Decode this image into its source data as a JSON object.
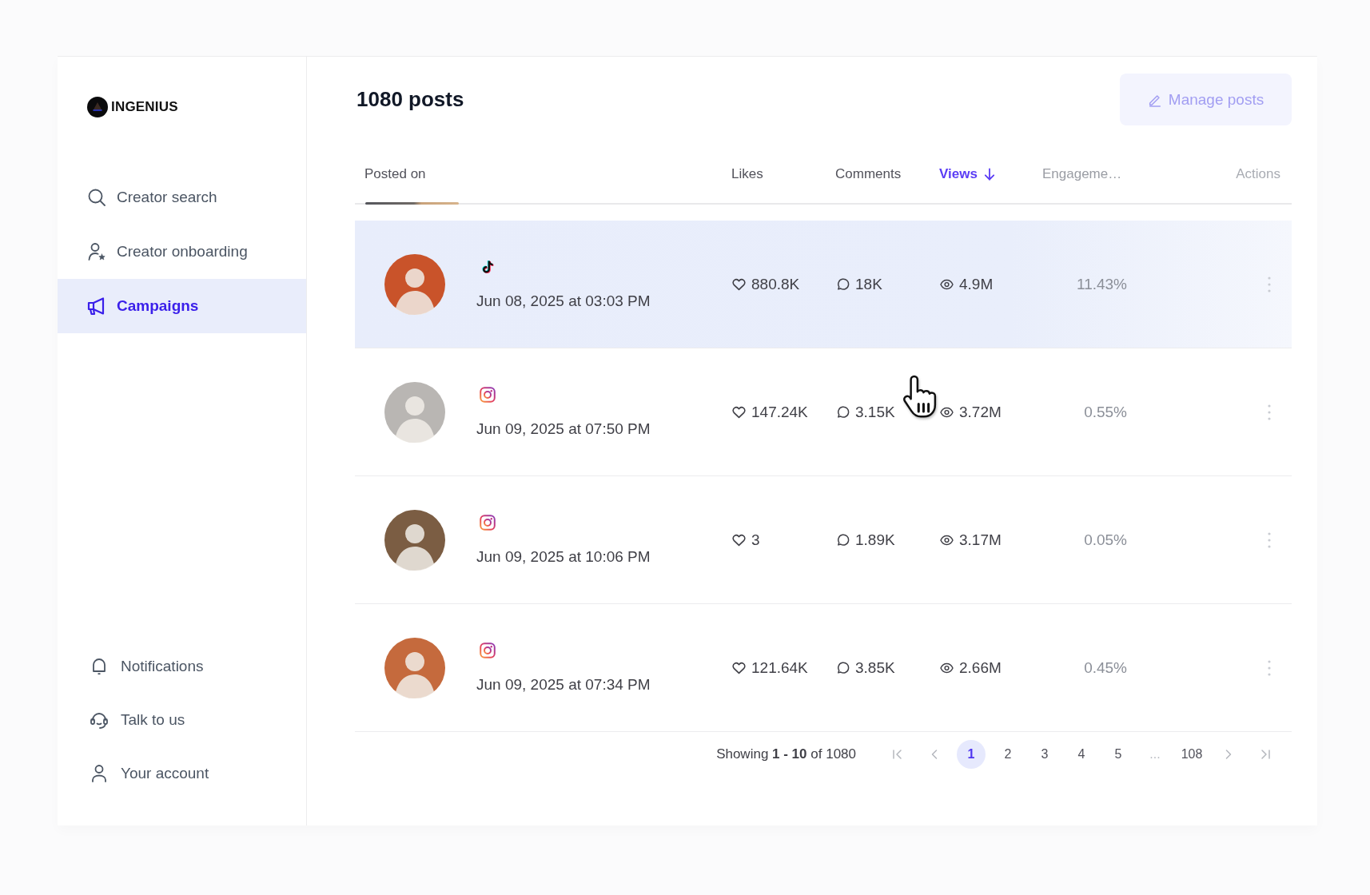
{
  "sidebar": {
    "logo": {
      "text": "INGENIUS"
    },
    "nav_items": [
      {
        "label": "Creator search",
        "selected": false
      },
      {
        "label": "Creator onboarding",
        "selected": false
      },
      {
        "label": "Campaigns",
        "selected": true
      }
    ],
    "bottom_items": [
      {
        "label": "Notifications"
      },
      {
        "label": "Talk to us"
      },
      {
        "label": "Your account"
      }
    ]
  },
  "header": {
    "title": "1080 posts",
    "manage_button": {
      "label": "Manage posts"
    }
  },
  "table": {
    "columns": [
      {
        "label": "Posted on",
        "sorted": false
      },
      {
        "label": "Likes",
        "sorted": false
      },
      {
        "label": "Comments",
        "sorted": false
      },
      {
        "label": "Views",
        "sorted": true
      },
      {
        "label": "Engageme…",
        "sorted": false
      },
      {
        "label": "Actions",
        "sorted": false
      }
    ],
    "rows": [
      {
        "selected": true,
        "kind": "tiktok",
        "posted_on": "Jun 08, 2025 at 03:03 PM",
        "likes": "880.8K",
        "comments": "18K",
        "views": "4.9M",
        "engagement": "11.43%"
      },
      {
        "selected": false,
        "kind": "instagram",
        "posted_on": "Jun 09, 2025 at 07:50 PM",
        "likes": "147.24K",
        "comments": "3.15K",
        "views": "3.72M",
        "engagement": "0.55%"
      },
      {
        "selected": false,
        "kind": "instagram",
        "posted_on": "Jun 09, 2025 at 10:06 PM",
        "likes": "3",
        "comments": "1.89K",
        "views": "3.17M",
        "engagement": "0.05%"
      },
      {
        "selected": false,
        "kind": "instagram",
        "posted_on": "Jun 09, 2025 at 07:34 PM",
        "likes": "121.64K",
        "comments": "3.85K",
        "views": "2.66M",
        "engagement": "0.45%"
      }
    ]
  },
  "pagination": {
    "summary": "Showing **1 - 10** of 1080",
    "pages": [
      {
        "kind": "page",
        "label": "1",
        "selected": true
      },
      {
        "kind": "page",
        "label": "2",
        "selected": false
      },
      {
        "kind": "page",
        "label": "3",
        "selected": false
      },
      {
        "kind": "page",
        "label": "4",
        "selected": false
      },
      {
        "kind": "page",
        "label": "5",
        "selected": false
      },
      {
        "kind": "ellipsis",
        "label": "..."
      },
      {
        "kind": "page",
        "label": "108",
        "selected": false
      }
    ]
  }
}
